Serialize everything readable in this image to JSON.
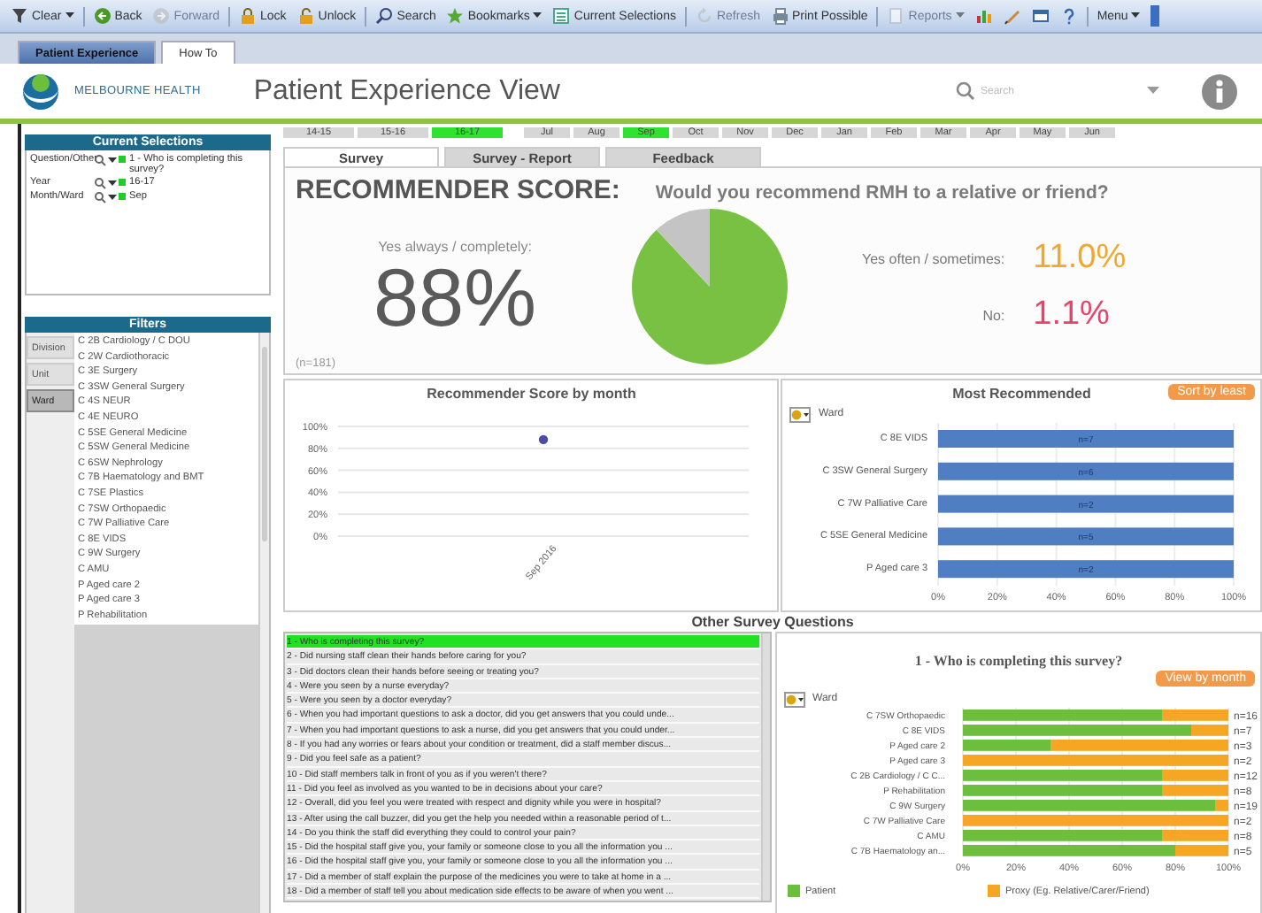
{
  "toolbar": {
    "items": [
      {
        "label": "Clear",
        "dropdown": true,
        "disabled": false
      },
      {
        "label": "Back",
        "dropdown": false,
        "disabled": false
      },
      {
        "label": "Forward",
        "dropdown": false,
        "disabled": true
      },
      {
        "label": "Lock",
        "dropdown": false,
        "disabled": false
      },
      {
        "label": "Unlock",
        "dropdown": false,
        "disabled": false
      },
      {
        "label": "Search",
        "dropdown": false,
        "disabled": false
      },
      {
        "label": "Bookmarks",
        "dropdown": true,
        "disabled": false
      },
      {
        "label": "Current Selections",
        "dropdown": false,
        "disabled": false
      },
      {
        "label": "Refresh",
        "dropdown": false,
        "disabled": true
      },
      {
        "label": "Print Possible",
        "dropdown": false,
        "disabled": false
      },
      {
        "label": "Reports",
        "dropdown": true,
        "disabled": true
      },
      {
        "label": "Menu",
        "dropdown": true,
        "disabled": false
      }
    ]
  },
  "doc_tabs": [
    {
      "label": "Patient Experience",
      "selected": true
    },
    {
      "label": "How To",
      "selected": false
    }
  ],
  "header": {
    "org": "MELBOURNE HEALTH",
    "title": "Patient Experience View",
    "search": {
      "placeholder": "Search"
    }
  },
  "current_selections": {
    "title": "Current Selections",
    "rows": [
      {
        "field": "Question/Other",
        "value": "1 - Who is completing this survey?"
      },
      {
        "field": "Year",
        "value": "16-17"
      },
      {
        "field": "Month/Ward",
        "value": "Sep"
      }
    ]
  },
  "filters": {
    "title": "Filters",
    "tabs": [
      {
        "label": "Division",
        "selected": false
      },
      {
        "label": "Unit",
        "selected": false
      },
      {
        "label": "Ward",
        "selected": true
      }
    ],
    "items": [
      "C 2B Cardiology / C DOU",
      "C 2W Cardiothoracic",
      "C 3E Surgery",
      "C 3SW General Surgery",
      "C 4S NEUR",
      "C 4E NEURO",
      "C 5SE General Medicine",
      "C 5SW General Medicine",
      "C 6SW Nephrology",
      "C 7B Haematology and BMT",
      "C 7SE Plastics",
      "C 7SW Orthopaedic",
      "C 7W Palliative Care",
      "C 8E VIDS",
      "C 9W Surgery",
      "C AMU",
      "P Aged care 2",
      "P Aged care 3",
      "P Rehabilitation"
    ]
  },
  "period": {
    "years": [
      {
        "label": "14-15",
        "selected": false
      },
      {
        "label": "15-16",
        "selected": false
      },
      {
        "label": "16-17",
        "selected": true
      }
    ],
    "months": [
      {
        "label": "Jul",
        "selected": false
      },
      {
        "label": "Aug",
        "selected": false
      },
      {
        "label": "Sep",
        "selected": true
      },
      {
        "label": "Oct",
        "selected": false
      },
      {
        "label": "Nov",
        "selected": false
      },
      {
        "label": "Dec",
        "selected": false
      },
      {
        "label": "Jan",
        "selected": false
      },
      {
        "label": "Feb",
        "selected": false
      },
      {
        "label": "Mar",
        "selected": false
      },
      {
        "label": "Apr",
        "selected": false
      },
      {
        "label": "May",
        "selected": false
      },
      {
        "label": "Jun",
        "selected": false
      }
    ]
  },
  "survey_tabs": [
    {
      "label": "Survey",
      "selected": true
    },
    {
      "label": "Survey - Report",
      "selected": false
    },
    {
      "label": "Feedback",
      "selected": false
    }
  ],
  "score": {
    "title": "RECOMMENDER SCORE:",
    "question": "Would you recommend RMH to a relative or friend?",
    "main_label": "Yes always / completely:",
    "main_value": "88%",
    "count": "(n=181)",
    "chart_data": {
      "type": "pie",
      "values": [
        88,
        12
      ]
    },
    "others": [
      {
        "label": "Yes often / sometimes:",
        "value": "11.0%",
        "color": "#f0a830"
      },
      {
        "label": "No:",
        "value": "1.1%",
        "color": "#e8436d"
      }
    ]
  },
  "score_by_month": {
    "title": "Recommender Score by month",
    "chart_data": {
      "type": "line",
      "grid": true,
      "marker": true,
      "categories": [
        "Sep 2016"
      ],
      "values": [
        88
      ],
      "ylim": [
        0,
        100
      ],
      "yticks": [
        {
          "value": 0,
          "label": "0%"
        },
        {
          "value": 20,
          "label": "20%"
        },
        {
          "value": 40,
          "label": "40%"
        },
        {
          "value": 60,
          "label": "60%"
        },
        {
          "value": 80,
          "label": "80%"
        },
        {
          "value": 100,
          "label": "100%"
        }
      ]
    }
  },
  "most_recommended": {
    "title": "Most Recommended",
    "sort_button": "Sort by least",
    "ward_label": "Ward",
    "counts": [
      "n=7",
      "n=6",
      "n=2",
      "n=5",
      "n=2"
    ],
    "chart_data": {
      "type": "bar",
      "orientation": "horizontal",
      "grid": true,
      "categories": [
        "C 8E VIDS",
        "C 3SW General Surgery",
        "C 7W Palliative Care",
        "C 5SE General Medicine",
        "P Aged care 3"
      ],
      "values": [
        100,
        100,
        100,
        100,
        100
      ],
      "xlim": [
        0,
        100
      ],
      "xticks": [
        {
          "value": 0,
          "label": "0%"
        },
        {
          "value": 20,
          "label": "20%"
        },
        {
          "value": 40,
          "label": "40%"
        },
        {
          "value": 60,
          "label": "60%"
        },
        {
          "value": 80,
          "label": "80%"
        },
        {
          "value": 100,
          "label": "100%"
        }
      ]
    }
  },
  "other_questions": {
    "title": "Other Survey Questions",
    "items": [
      {
        "label": "1 - Who is completing this survey?",
        "selected": true
      },
      {
        "label": "2 - Did nursing staff clean their hands before caring for you?",
        "selected": false
      },
      {
        "label": "3 - Did doctors clean their hands before seeing or treating you?",
        "selected": false
      },
      {
        "label": "4 - Were you seen by a nurse everyday?",
        "selected": false
      },
      {
        "label": "5 - Were you seen by a doctor everyday?",
        "selected": false
      },
      {
        "label": "6 - When you had important questions to ask a doctor, did you get answers that you could unde...",
        "selected": false
      },
      {
        "label": "7 - When you had important questions to ask a nurse, did you get answers that you could under...",
        "selected": false
      },
      {
        "label": "8 - If you had any worries or fears about your condition or treatment, did a staff member discus...",
        "selected": false
      },
      {
        "label": "9 - Did you feel safe as a patient?",
        "selected": false
      },
      {
        "label": "10 - Did staff members talk in front of you as if you weren't there?",
        "selected": false
      },
      {
        "label": "11 - Did you feel as involved as you wanted to be in decisions about your care?",
        "selected": false
      },
      {
        "label": "12 - Overall, did you feel you were treated with respect and dignity while you were in hospital?",
        "selected": false
      },
      {
        "label": "13 - After using the call buzzer, did you get the help you needed within a reasonable period of t...",
        "selected": false
      },
      {
        "label": "14 - Do you think the staff did everything they could to control your pain?",
        "selected": false
      },
      {
        "label": "15 - Did the hospital staff give you, your family or someone close to you all the information you ...",
        "selected": false
      },
      {
        "label": "16 - Did the hospital staff give you, your family or someone close to you all the information you ...",
        "selected": false
      },
      {
        "label": "17 - Did a member of staff explain the purpose of the medicines you were to take at home in a ...",
        "selected": false
      },
      {
        "label": "18 - Did a member of staff tell you about medication side effects to be aware of when you went ...",
        "selected": false
      }
    ],
    "chart": {
      "title": "1 - Who is completing this survey?",
      "button": "View by month",
      "ward_label": "Ward",
      "counts": [
        "n=16",
        "n=7",
        "n=3",
        "n=2",
        "n=12",
        "n=8",
        "n=19",
        "n=2",
        "n=8",
        "n=5"
      ],
      "chart_data": {
        "type": "bar",
        "orientation": "horizontal",
        "stacked": true,
        "grid": true,
        "categories": [
          "C 7SW Orthopaedic",
          "C 8E VIDS",
          "P Aged care 2",
          "P Aged care 3",
          "C 2B Cardiology / C C...",
          "P Rehabilitation",
          "C 9W Surgery",
          "C 7W Palliative Care",
          "C AMU",
          "C 7B Haematology an..."
        ],
        "series": [
          {
            "name": "Patient",
            "color": "#6cbf3c",
            "values": [
              75,
              86,
              33,
              0,
              75,
              75,
              95,
              0,
              75,
              80
            ]
          },
          {
            "name": "Proxy (Eg. Relative/Carer/Friend)",
            "color": "#f5a623",
            "values": [
              25,
              14,
              67,
              100,
              25,
              25,
              5,
              100,
              25,
              20
            ]
          }
        ],
        "xlim": [
          0,
          100
        ],
        "xticks": [
          {
            "value": 0,
            "label": "0%"
          },
          {
            "value": 20,
            "label": "20%"
          },
          {
            "value": 40,
            "label": "40%"
          },
          {
            "value": 60,
            "label": "60%"
          },
          {
            "value": 80,
            "label": "80%"
          },
          {
            "value": 100,
            "label": "100%"
          }
        ]
      }
    }
  }
}
